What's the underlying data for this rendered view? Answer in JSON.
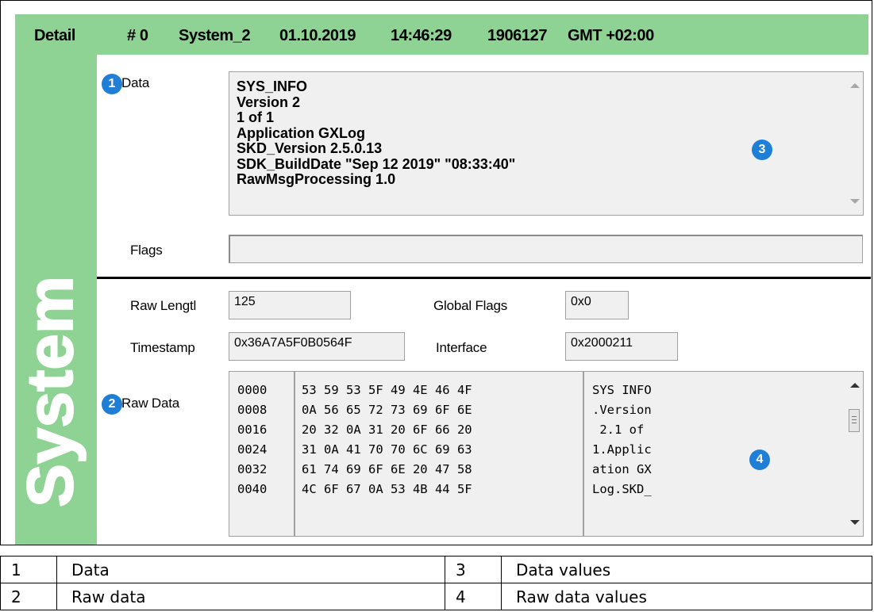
{
  "header": {
    "label": "Detail",
    "index": "# 0",
    "source": "System_2",
    "date": "01.10.2019",
    "time": "14:46:29",
    "ticks": "1906127",
    "timezone": "GMT +02:00"
  },
  "sidebar": {
    "title": "System"
  },
  "colors": {
    "accent": "#8ed394",
    "badge": "#1f7fd6"
  },
  "data_section": {
    "badge": "1",
    "label": "Data",
    "lines": [
      "SYS_INFO",
      "Version 2",
      "1 of 1",
      "Application GXLog",
      "SKD_Version 2.5.0.13",
      "SDK_BuildDate \"Sep 12 2019\" \"08:33:40\"",
      "RawMsgProcessing 1.0"
    ],
    "callout": "3"
  },
  "flags": {
    "label": "Flags",
    "value": ""
  },
  "raw_length": {
    "label": "Raw Lengtl",
    "value": "125"
  },
  "global_flags": {
    "label": "Global Flags",
    "value": "0x0"
  },
  "timestamp": {
    "label": "Timestamp",
    "value": "0x36A7A5F0B0564F"
  },
  "interface": {
    "label": "Interface",
    "value": "0x2000211"
  },
  "raw_data": {
    "badge": "2",
    "label": "Raw Data",
    "offsets": [
      "0000",
      "0008",
      "0016",
      "0024",
      "0032",
      "0040"
    ],
    "hex": [
      "53 59 53 5F 49 4E 46 4F",
      "0A 56 65 72 73 69 6F 6E",
      "20 32 0A 31 20 6F 66 20",
      "31 0A 41 70 70 6C 69 63",
      "61 74 69 6F 6E 20 47 58",
      "4C 6F 67 0A 53 4B 44 5F"
    ],
    "ascii": [
      "SYS INFO",
      ".Version",
      " 2.1 of",
      "1.Applic",
      "ation GX",
      "Log.SKD_"
    ],
    "callout": "4"
  },
  "legend": [
    {
      "num": "1",
      "text": "Data",
      "num2": "3",
      "text2": "Data values"
    },
    {
      "num": "2",
      "text": "Raw data",
      "num2": "4",
      "text2": "Raw data values"
    }
  ]
}
